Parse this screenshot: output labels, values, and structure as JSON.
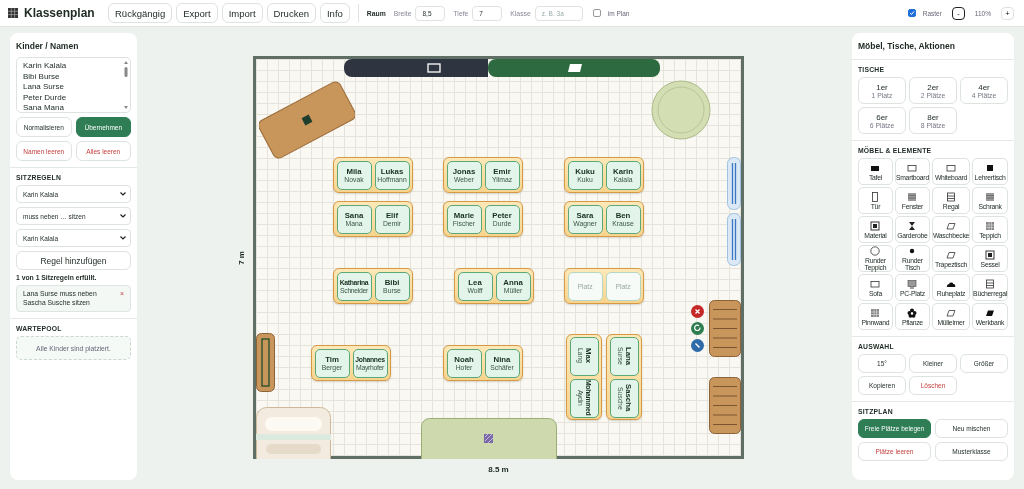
{
  "app": {
    "title": "Klassenplan"
  },
  "toolbar": {
    "buttons": [
      "Rückgängig",
      "Export",
      "Import",
      "Drucken",
      "Info"
    ],
    "room": {
      "label": "Raum",
      "fields": [
        {
          "label": "Breite",
          "value": "8,5"
        },
        {
          "label": "Tiefe",
          "value": "7"
        },
        {
          "label": "Klasse",
          "placeholder": "z. B. 3a"
        }
      ],
      "in_plan": {
        "label": "im Plan",
        "checked": false
      }
    },
    "grid": {
      "label": "Raster",
      "checked": true
    },
    "zoom": {
      "minus": "-",
      "value": "110%",
      "plus": "+"
    }
  },
  "left_panel": {
    "title": "Kinder / Namen",
    "names": [
      "Karin Kalala",
      "Bibi Burse",
      "Lana Surse",
      "Peter Durde",
      "Sana Mana"
    ],
    "buttons": [
      {
        "label": "Normalisieren",
        "kind": "default"
      },
      {
        "label": "Übernehmen",
        "kind": "primary"
      },
      {
        "label": "Namen leeren",
        "kind": "danger"
      },
      {
        "label": "Alles leeren",
        "kind": "danger"
      }
    ],
    "rules": {
      "title": "SITZREGELN",
      "selects": [
        "Karin Kalala",
        "muss neben … sitzen",
        "Karin Kalala"
      ],
      "add_button": "Regel hinzufügen",
      "status": "1 von 1 Sitzregeln erfüllt.",
      "items": [
        {
          "text": "Lana Surse muss neben Sascha Susche sitzen",
          "remove": "×"
        }
      ]
    },
    "waiting_pool": {
      "title": "WARTEPOOL",
      "empty_text": "Alle Kinder sind platziert."
    }
  },
  "room": {
    "depth_label": "7 m",
    "width_label": "8.5 m",
    "tables": [
      {
        "kind": "horizontal",
        "seats": [
          {
            "first": "Mila",
            "last": "Novak",
            "empty": false
          },
          {
            "first": "Lukas",
            "last": "Hoffmann",
            "empty": false
          }
        ]
      },
      {
        "kind": "horizontal",
        "seats": [
          {
            "first": "Jonas",
            "last": "Weber",
            "empty": false
          },
          {
            "first": "Emir",
            "last": "Yilmaz",
            "empty": false
          }
        ]
      },
      {
        "kind": "horizontal",
        "seats": [
          {
            "first": "Kuku",
            "last": "Kuku",
            "empty": false
          },
          {
            "first": "Karin",
            "last": "Kalala",
            "empty": false
          }
        ]
      },
      {
        "kind": "horizontal",
        "seats": [
          {
            "first": "Sana",
            "last": "Mana",
            "empty": false
          },
          {
            "first": "Elif",
            "last": "Demir",
            "empty": false
          }
        ]
      },
      {
        "kind": "horizontal",
        "seats": [
          {
            "first": "Marie",
            "last": "Fischer",
            "empty": false
          },
          {
            "first": "Peter",
            "last": "Durde",
            "empty": false
          }
        ]
      },
      {
        "kind": "horizontal",
        "seats": [
          {
            "first": "Sara",
            "last": "Wagner",
            "empty": false
          },
          {
            "first": "Ben",
            "last": "Krause",
            "empty": false
          }
        ]
      },
      {
        "kind": "horizontal",
        "seats": [
          {
            "first": "Katharina",
            "last": "Schneider",
            "empty": false
          },
          {
            "first": "Bibi",
            "last": "Burse",
            "empty": false
          }
        ]
      },
      {
        "kind": "horizontal",
        "seats": [
          {
            "first": "Lea",
            "last": "Wolff",
            "empty": false
          },
          {
            "first": "Anna",
            "last": "Müller",
            "empty": false
          }
        ]
      },
      {
        "kind": "horizontal",
        "seats": [
          {
            "first": "Platz",
            "empty": true
          },
          {
            "first": "Platz",
            "empty": true
          }
        ]
      },
      {
        "kind": "horizontal",
        "seats": [
          {
            "first": "Tim",
            "last": "Berger",
            "empty": false
          },
          {
            "first": "Johannes",
            "last": "Mayrhofer",
            "empty": false
          }
        ]
      },
      {
        "kind": "horizontal",
        "seats": [
          {
            "first": "Noah",
            "last": "Hofer",
            "empty": false
          },
          {
            "first": "Nina",
            "last": "Schäfer",
            "empty": false
          }
        ]
      },
      {
        "kind": "vertical",
        "seats": [
          {
            "first": "Max",
            "last": "Lang",
            "empty": false
          },
          {
            "first": "Mohammed",
            "last": "Aydin",
            "empty": false
          }
        ]
      },
      {
        "kind": "vertical",
        "seats": [
          {
            "first": "Lana",
            "last": "Surse",
            "empty": false
          },
          {
            "first": "Sascha",
            "last": "Susche",
            "empty": false
          }
        ]
      }
    ]
  },
  "right_panel": {
    "title": "Möbel, Tische, Aktionen",
    "tables": {
      "title": "TISCHE",
      "items": [
        {
          "label": "1er",
          "sub": "1 Platz"
        },
        {
          "label": "2er",
          "sub": "2 Plätze"
        },
        {
          "label": "4er",
          "sub": "4 Plätze"
        },
        {
          "label": "6er",
          "sub": "6 Plätze"
        },
        {
          "label": "8er",
          "sub": "8 Plätze"
        }
      ]
    },
    "furniture": {
      "title": "MÖBEL & ELEMENTE",
      "items": [
        "Tafel",
        "Smartboard",
        "Whiteboard",
        "Lehrertisch",
        "Tür",
        "Fenster",
        "Regal",
        "Schrank",
        "Material",
        "Garderobe",
        "Waschbecke",
        "Teppich",
        "Runder Teppich",
        "Runder Tisch",
        "Trapeztisch",
        "Sessel",
        "Sofa",
        "PC-Platz",
        "Ruheplatz",
        "Bücherregal",
        "Pinnwand",
        "Pflanze",
        "Mülleimer",
        "Werkbank"
      ]
    },
    "selection": {
      "title": "AUSWAHL",
      "buttons": [
        {
          "label": "15°",
          "kind": "default"
        },
        {
          "label": "Kleiner",
          "kind": "default"
        },
        {
          "label": "Größer",
          "kind": "default"
        },
        {
          "label": "Kopieren",
          "kind": "default"
        },
        {
          "label": "Löschen",
          "kind": "danger"
        }
      ]
    },
    "seating": {
      "title": "SITZPLAN",
      "buttons": [
        {
          "label": "Freie Plätze belegen",
          "kind": "primary"
        },
        {
          "label": "Neu mischen",
          "kind": "default"
        },
        {
          "label": "Plätze leeren",
          "kind": "danger"
        },
        {
          "label": "Musterklasse",
          "kind": "default"
        }
      ]
    }
  }
}
